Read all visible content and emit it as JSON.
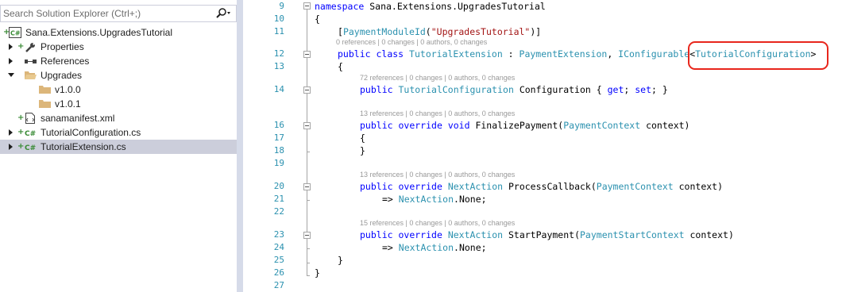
{
  "solution_explorer": {
    "search_placeholder": "Search Solution Explorer (Ctrl+;)",
    "tree": [
      {
        "label": "Sana.Extensions.UpgradesTutorial",
        "icon": "csharp-project-icon",
        "expander": "none",
        "added": true
      },
      {
        "label": "Properties",
        "icon": "wrench-icon",
        "expander": "right",
        "added": true
      },
      {
        "label": "References",
        "icon": "references-icon",
        "expander": "right",
        "added": false
      },
      {
        "label": "Upgrades",
        "icon": "folder-open-icon",
        "expander": "down",
        "added": false
      },
      {
        "label": "v1.0.0",
        "icon": "folder-icon",
        "expander": "none",
        "added": false
      },
      {
        "label": "v1.0.1",
        "icon": "folder-icon",
        "expander": "none",
        "added": false
      },
      {
        "label": "sanamanifest.xml",
        "icon": "xml-file-icon",
        "expander": "none",
        "added": true
      },
      {
        "label": "TutorialConfiguration.cs",
        "icon": "csharp-file-icon",
        "expander": "right",
        "added": true
      },
      {
        "label": "TutorialExtension.cs",
        "icon": "csharp-file-icon",
        "expander": "right",
        "added": true,
        "selected": true
      }
    ]
  },
  "editor": {
    "line_numbers": [
      "9",
      "10",
      "11",
      "12",
      "13",
      "14",
      "16",
      "17",
      "18",
      "19",
      "20",
      "21",
      "22",
      "23",
      "24",
      "25",
      "26",
      "27"
    ],
    "lens": [
      "0 references | 0 changes | 0 authors, 0 changes",
      "72 references | 0 changes | 0 authors, 0 changes",
      "13 references | 0 changes | 0 authors, 0 changes",
      "13 references | 0 changes | 0 authors, 0 changes",
      "15 references | 0 changes | 0 authors, 0 changes"
    ],
    "tokens": {
      "namespace": "namespace",
      "ns_name": " Sana.Extensions.UpgradesTutorial",
      "brace_open": "{",
      "brace_close": "}",
      "attr_open": "[",
      "attr_name": "PaymentModuleId",
      "attr_paren_open": "(",
      "attr_string": "\"UpgradesTutorial\"",
      "attr_close": ")]",
      "public": "public",
      "class": "class",
      "class_name": "TutorialExtension",
      "colon": " : ",
      "base_type": "PaymentExtension",
      "comma": ", ",
      "interface_type": "IConfigurable",
      "lt": "<",
      "generic_arg": "TutorialConfiguration",
      "gt": ">",
      "config_type": "TutorialConfiguration",
      "config_rest": " Configuration { ",
      "get": "get",
      "semi_sp": "; ",
      "set": "set",
      "config_end": "; }",
      "override": "override",
      "void": "void",
      "finalize_name": " FinalizePayment(",
      "payment_context": "PaymentContext",
      "context_param": " context)",
      "next_action": "NextAction",
      "process_name": " ProcessCallback(",
      "arrow": "=> ",
      "none_suffix": ".None;",
      "start_name": " StartPayment(",
      "payment_start_context": "PaymentStartContext"
    }
  },
  "colors": {
    "keyword": "#0000ff",
    "type": "#2b91af",
    "string": "#a31515",
    "line_number": "#2b91af",
    "codelens": "#999999",
    "callout_border": "#e8261c",
    "selection": "#cccedb"
  }
}
